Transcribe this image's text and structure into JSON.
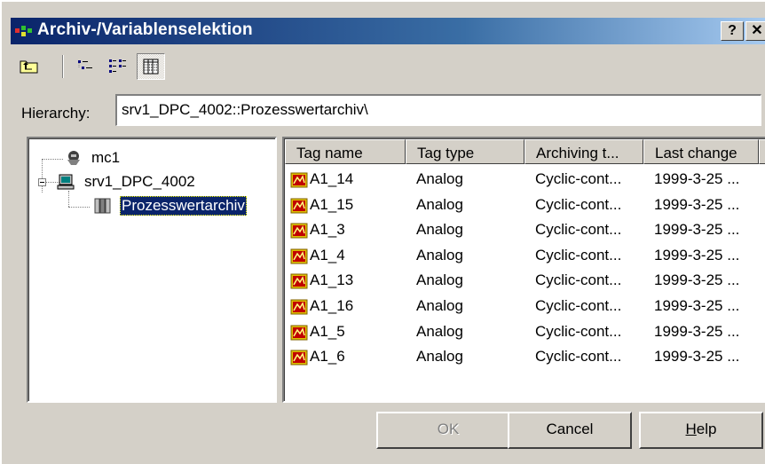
{
  "window": {
    "title": "Archiv-/Variablenselektion",
    "help_button": "?",
    "close_button": "✕"
  },
  "toolbar": {
    "buttons": [
      {
        "name": "up-folder",
        "icon": "folder-up-icon"
      },
      {
        "name": "large-icons",
        "icon": "large-icons-view-icon"
      },
      {
        "name": "list-view",
        "icon": "list-view-icon"
      },
      {
        "name": "details-view",
        "icon": "details-view-icon",
        "pressed": true
      }
    ]
  },
  "hierarchy": {
    "label": "Hierarchy:",
    "value": "srv1_DPC_4002::Prozesswertarchiv\\"
  },
  "tree": {
    "nodes": [
      {
        "label": "mc1",
        "icon": "computer-node-icon"
      },
      {
        "label": "srv1_DPC_4002",
        "icon": "server-computer-icon",
        "expanded": true
      },
      {
        "label": "Prozesswertarchiv",
        "icon": "archive-icon",
        "selected": true
      }
    ]
  },
  "table": {
    "columns": [
      "Tag name",
      "Tag type",
      "Archiving t...",
      "Last change"
    ],
    "rows": [
      {
        "name": "A1_14",
        "type": "Analog",
        "archiving": "Cyclic-cont...",
        "last_change": "1999-3-25 ..."
      },
      {
        "name": "A1_15",
        "type": "Analog",
        "archiving": "Cyclic-cont...",
        "last_change": "1999-3-25 ..."
      },
      {
        "name": "A1_3",
        "type": "Analog",
        "archiving": "Cyclic-cont...",
        "last_change": "1999-3-25 ..."
      },
      {
        "name": "A1_4",
        "type": "Analog",
        "archiving": "Cyclic-cont...",
        "last_change": "1999-3-25 ..."
      },
      {
        "name": "A1_13",
        "type": "Analog",
        "archiving": "Cyclic-cont...",
        "last_change": "1999-3-25 ..."
      },
      {
        "name": "A1_16",
        "type": "Analog",
        "archiving": "Cyclic-cont...",
        "last_change": "1999-3-25 ..."
      },
      {
        "name": "A1_5",
        "type": "Analog",
        "archiving": "Cyclic-cont...",
        "last_change": "1999-3-25 ..."
      },
      {
        "name": "A1_6",
        "type": "Analog",
        "archiving": "Cyclic-cont...",
        "last_change": "1999-3-25 ..."
      }
    ]
  },
  "buttons": {
    "ok": "OK",
    "cancel": "Cancel",
    "help_prefix": "H",
    "help_rest": "elp"
  },
  "colors": {
    "dialog_face": "#d4d0c8",
    "title_active": "#0a246a",
    "selection": "#0a246a"
  }
}
